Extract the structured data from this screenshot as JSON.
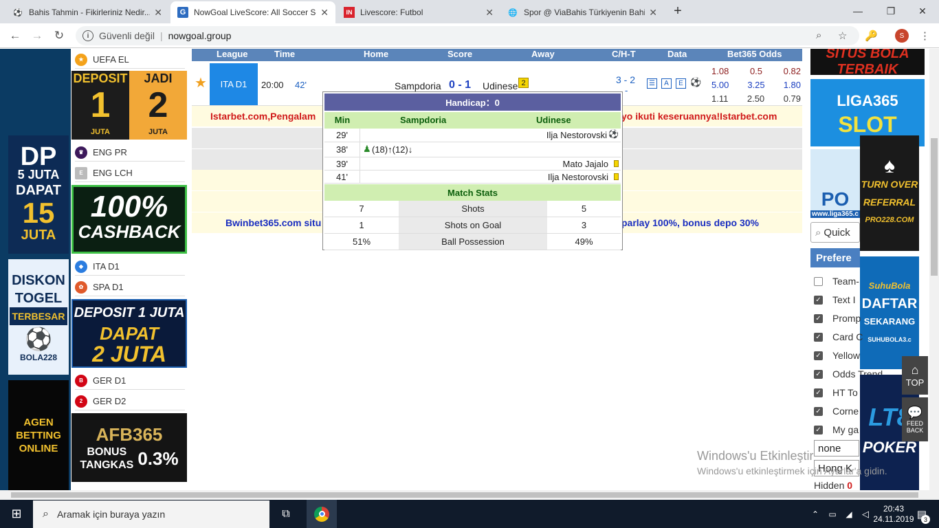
{
  "browser": {
    "tabs": [
      {
        "title": "Bahis Tahmin - Fikirleriniz Nedir...",
        "icon": "soccer-ball-icon"
      },
      {
        "title": "NowGoal LiveScore: All Soccer Sc",
        "icon": "g-logo-icon"
      },
      {
        "title": "Livescore: Futbol",
        "icon": "in-logo-icon"
      },
      {
        "title": "Spor @ ViaBahis Türkiyenin Bahis",
        "icon": "globe-icon"
      }
    ],
    "new_tab": "+",
    "security": "Güvenli değil",
    "url": "nowgoal.group",
    "profile": "S"
  },
  "leagues_top": "UEFA EL",
  "sidebar_leagues": [
    "ENG PR",
    "ENG LCH",
    "ITA D1",
    "SPA D1",
    "GER D1",
    "GER D2"
  ],
  "banners": {
    "deposit": {
      "l1": "DEPOSIT",
      "n1": "1",
      "u1": "JUTA",
      "l2": "JADI",
      "n2": "2",
      "u2": "JUTA"
    },
    "cashback": {
      "l1": "100%",
      "l2": "CASHBACK"
    },
    "deposit2": {
      "l1": "DEPOSIT 1 JUTA",
      "l2": "DAPAT",
      "l3": "2 JUTA"
    },
    "afb": {
      "l1": "AFB365",
      "l2": "BONUS",
      "l3": "TANGKAS",
      "l4": "0.3%"
    },
    "dp": {
      "l1": "DP",
      "l2": "5 JUTA",
      "l3": "DAPAT",
      "l4": "15",
      "l5": "JUTA"
    },
    "togel": {
      "l1": "DISKON",
      "l2": "TOGEL",
      "l3": "TERBESAR",
      "l4": "BOLA228"
    },
    "agen": {
      "l1": "AGEN",
      "l2": "BETTING",
      "l3": "ONLINE"
    },
    "situs": "SITUS BOLA TERBAIK",
    "liga": {
      "l1": "LIGA365",
      "l2": "SLOT"
    },
    "liga_url": "www.liga365.c",
    "pro": {
      "l1": "TURN OVER",
      "l2": "REFERRAL",
      "l3": "PRO228.COM"
    },
    "suhu": {
      "l1": "SuhuBola",
      "l2": "DAFTAR",
      "l3": "SEKARANG",
      "l4": "SUHUBOLA3.c"
    },
    "poker": {
      "l1": "LT8",
      "l2": "POKER"
    }
  },
  "table": {
    "headers": [
      "League",
      "Time",
      "Home",
      "Score",
      "Away",
      "C/H-T",
      "Data",
      "Bet365 Odds"
    ],
    "match": {
      "league": "ITA D1",
      "time": "20:00",
      "minute": "42'",
      "home": "Sampdoria",
      "score": "0 - 1",
      "away": "Udinese",
      "away_cards": "2",
      "corners": "3 - 2",
      "ht": "-",
      "data_links": [
        "A",
        "E"
      ],
      "odds": [
        [
          "1.08",
          "0.5",
          "0.82"
        ],
        [
          "5.00",
          "3.25",
          "1.80"
        ],
        [
          "1.11",
          "2.50",
          "0.79"
        ]
      ]
    },
    "ad_red": "Istarbet.com,Pengalam",
    "ad_red_tail": "yo ikuti keseruannya!Istarbet.com",
    "ad_blue": "Bwinbet365.com situ",
    "ad_blue_tail": "parlay 100%, bonus depo 30%"
  },
  "popup": {
    "handicap": "Handicap：0",
    "cols": [
      "Min",
      "Sampdoria",
      "Udinese"
    ],
    "events": [
      {
        "min": "29'",
        "away": "Ilja Nestorovski",
        "icon": "goal-ball-icon"
      },
      {
        "min": "38'",
        "home": "(18)↑(12)↓",
        "icon": "substitution-icon"
      },
      {
        "min": "39'",
        "away": "Mato Jajalo",
        "icon": "yellow-card-icon"
      },
      {
        "min": "41'",
        "away": "Ilja Nestorovski",
        "icon": "yellow-card-icon"
      }
    ],
    "stats_title": "Match Stats",
    "stats": [
      {
        "home": "7",
        "label": "Shots",
        "away": "5"
      },
      {
        "home": "1",
        "label": "Shots on Goal",
        "away": "3"
      },
      {
        "home": "51%",
        "label": "Ball Possession",
        "away": "49%"
      }
    ]
  },
  "right": {
    "search": "Quick",
    "pref_title": "Prefere",
    "prefs": [
      {
        "label": "Team-",
        "checked": false
      },
      {
        "label": "Text I",
        "checked": true
      },
      {
        "label": "Promp",
        "checked": true
      },
      {
        "label": "Card C",
        "checked": true
      },
      {
        "label": "Yellow",
        "checked": true
      },
      {
        "label": "Odds Trend",
        "checked": true
      },
      {
        "label": "HT To",
        "checked": true
      },
      {
        "label": "Corne",
        "checked": true
      },
      {
        "label": "My ga",
        "checked": true
      }
    ],
    "select1": "none",
    "select2": "Hong K",
    "hidden_label": "Hidden",
    "hidden_count": "0",
    "top_label": "TOP",
    "feedback": "FEED BACK"
  },
  "watermark": {
    "l1": "Windows'u Etkinleştir",
    "l2": "Windows'u etkinleştirmek için Ayarlar'a gidin."
  },
  "taskbar": {
    "search": "Aramak için buraya yazın",
    "time": "20:43",
    "date": "24.11.2019",
    "notif": "3"
  }
}
